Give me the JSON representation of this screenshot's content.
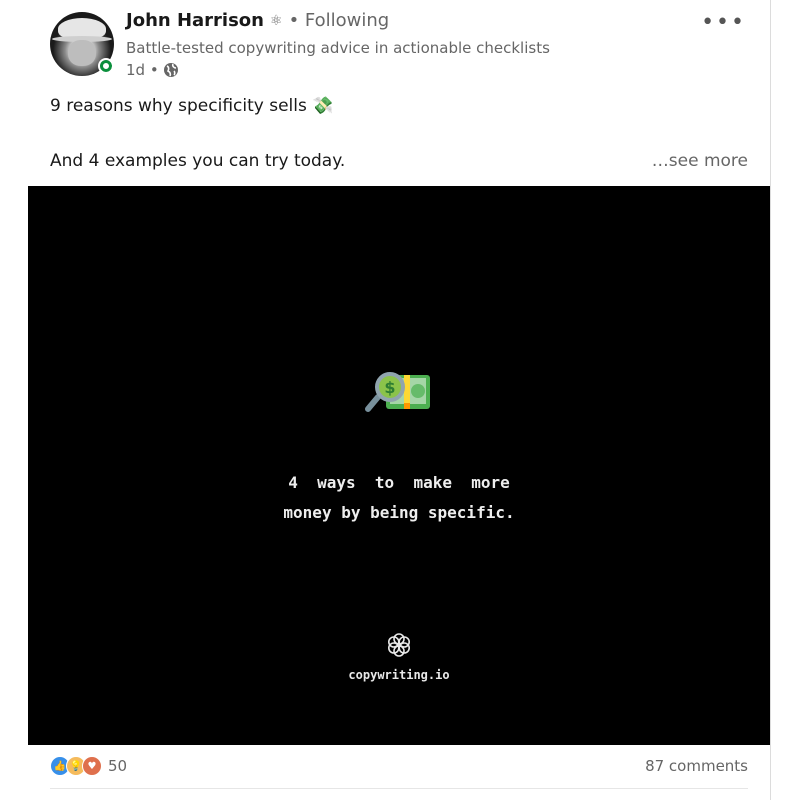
{
  "post": {
    "author": {
      "name": "John Harrison",
      "badge_icon": "atom-icon",
      "follow_status": "• Following",
      "headline": "Battle-tested copywriting advice in actionable checklists",
      "time": "1d •",
      "visibility_icon": "globe-icon",
      "online": true
    },
    "menu_label": "•••",
    "text_line1": "9 reasons why specificity sells 💸",
    "text_line2": "And 4 examples you can try today.",
    "see_more": "…see more",
    "media": {
      "emoji_icon": "money-magnifier-icon",
      "title": "4  ways  to  make  more\nmoney by being specific.",
      "brand": "copywriting.io",
      "logo_icon": "flower-logo-icon"
    },
    "social": {
      "reaction_icons": [
        "like-icon",
        "insightful-icon",
        "love-icon"
      ],
      "reaction_count": "50",
      "comments": "87 comments"
    }
  },
  "colors": {
    "presence": "#0a8f3c",
    "like": "#378fe9",
    "insightful": "#f5bb5c",
    "love": "#df704d",
    "media_bg": "#000000"
  }
}
